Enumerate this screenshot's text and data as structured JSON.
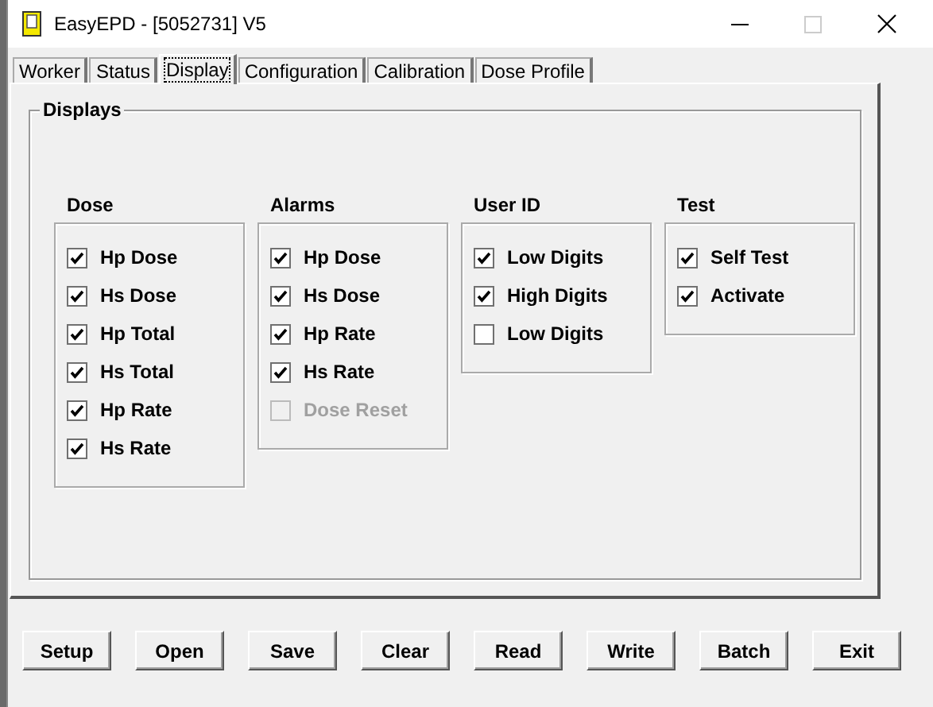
{
  "window": {
    "title": "EasyEPD - [5052731] V5"
  },
  "tabs": [
    {
      "label": "Worker",
      "selected": false
    },
    {
      "label": "Status",
      "selected": false
    },
    {
      "label": "Display",
      "selected": true
    },
    {
      "label": "Configuration",
      "selected": false
    },
    {
      "label": "Calibration",
      "selected": false
    },
    {
      "label": "Dose Profile",
      "selected": false
    }
  ],
  "group": {
    "title": "Displays",
    "sections": [
      {
        "title": "Dose",
        "items": [
          {
            "label": "Hp Dose",
            "checked": true,
            "disabled": false
          },
          {
            "label": "Hs Dose",
            "checked": true,
            "disabled": false
          },
          {
            "label": "Hp Total",
            "checked": true,
            "disabled": false
          },
          {
            "label": "Hs Total",
            "checked": true,
            "disabled": false
          },
          {
            "label": "Hp Rate",
            "checked": true,
            "disabled": false
          },
          {
            "label": "Hs Rate",
            "checked": true,
            "disabled": false
          }
        ]
      },
      {
        "title": "Alarms",
        "items": [
          {
            "label": "Hp Dose",
            "checked": true,
            "disabled": false
          },
          {
            "label": "Hs Dose",
            "checked": true,
            "disabled": false
          },
          {
            "label": "Hp Rate",
            "checked": true,
            "disabled": false
          },
          {
            "label": "Hs Rate",
            "checked": true,
            "disabled": false
          },
          {
            "label": "Dose Reset",
            "checked": false,
            "disabled": true
          }
        ]
      },
      {
        "title": "User ID",
        "items": [
          {
            "label": "Low Digits",
            "checked": true,
            "disabled": false
          },
          {
            "label": "High Digits",
            "checked": true,
            "disabled": false
          },
          {
            "label": "Low Digits",
            "checked": false,
            "disabled": false
          }
        ]
      },
      {
        "title": "Test",
        "items": [
          {
            "label": "Self Test",
            "checked": true,
            "disabled": false
          },
          {
            "label": "Activate",
            "checked": true,
            "disabled": false
          }
        ]
      }
    ]
  },
  "buttons": [
    "Setup",
    "Open",
    "Save",
    "Clear",
    "Read",
    "Write",
    "Batch",
    "Exit"
  ]
}
